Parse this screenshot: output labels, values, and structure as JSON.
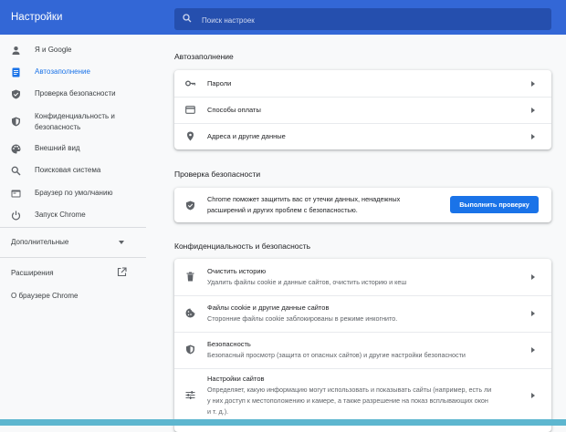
{
  "header": {
    "title": "Настройки",
    "search_placeholder": "Поиск настроек"
  },
  "sidebar": {
    "items": [
      {
        "label": "Я и Google",
        "icon": "person-icon"
      },
      {
        "label": "Автозаполнение",
        "icon": "autofill-icon"
      },
      {
        "label": "Проверка безопасности",
        "icon": "shield-check-icon"
      },
      {
        "label": "Конфиденциальность и\nбезопасность",
        "icon": "shield-icon"
      },
      {
        "label": "Внешний вид",
        "icon": "palette-icon"
      },
      {
        "label": "Поисковая система",
        "icon": "search-icon"
      },
      {
        "label": "Браузер по умолчанию",
        "icon": "browser-icon"
      },
      {
        "label": "Запуск Chrome",
        "icon": "power-icon"
      }
    ],
    "advanced": "Дополнительные",
    "extensions": "Расширения",
    "about": "О браузере Chrome"
  },
  "autofill": {
    "title": "Автозаполнение",
    "rows": [
      {
        "label": "Пароли",
        "icon": "key-icon"
      },
      {
        "label": "Способы оплаты",
        "icon": "credit-card-icon"
      },
      {
        "label": "Адреса и другие данные",
        "icon": "location-pin-icon"
      }
    ]
  },
  "safety": {
    "title": "Проверка безопасности",
    "text": "Chrome поможет защитить вас от утечки данных, ненадежных\nрасширений и других проблем с безопасностью.",
    "button": "Выполнить проверку"
  },
  "privacy": {
    "title": "Конфиденциальность и безопасность",
    "rows": [
      {
        "label": "Очистить историю",
        "sub": "Удалить файлы cookie и данные сайтов, очистить историю и кеш",
        "icon": "trash-icon"
      },
      {
        "label": "Файлы cookie и другие данные сайтов",
        "sub": "Сторонние файлы cookie заблокированы в режиме инкогнито.",
        "icon": "cookie-icon"
      },
      {
        "label": "Безопасность",
        "sub": "Безопасный просмотр (защита от опасных сайтов) и другие настройки безопасности",
        "icon": "security-shield-icon"
      },
      {
        "label": "Настройки сайтов",
        "sub": "Определяет, какую информацию могут использовать и показывать сайты (например, есть ли\nу них доступ к местоположению и камере, а также разрешение на показ всплывающих окон\nи т. д.).",
        "icon": "sliders-icon"
      }
    ]
  },
  "colors": {
    "header": "#3367d6",
    "accent": "#1a73e8"
  }
}
